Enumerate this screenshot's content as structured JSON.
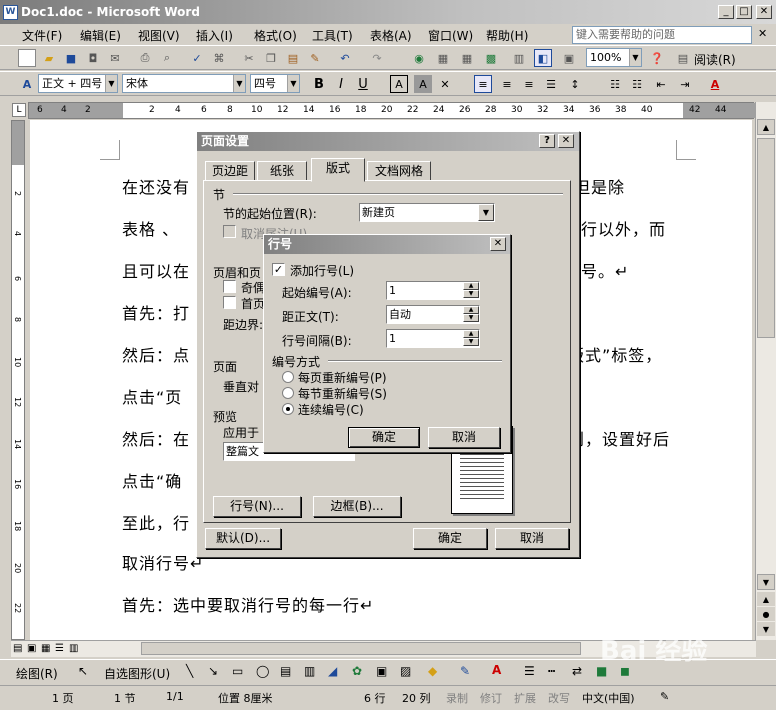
{
  "window": {
    "title": "Doc1.doc - Microsoft Word",
    "minimize": "_",
    "maximize": "□",
    "close": "✕"
  },
  "menu": {
    "items": [
      "文件(F)",
      "编辑(E)",
      "视图(V)",
      "插入(I)",
      "格式(O)",
      "工具(T)",
      "表格(A)",
      "窗口(W)",
      "帮助(H)"
    ],
    "help_placeholder": "键入需要帮助的问题"
  },
  "toolbar": {
    "zoom": "100%",
    "read_label": "阅读(R)"
  },
  "format_bar": {
    "style": "正文 + 四号",
    "font": "宋体",
    "size": "四号",
    "bold": "B",
    "italic": "I",
    "underline": "U"
  },
  "ruler": {
    "numbers": [
      "6",
      "4",
      "2",
      "2",
      "4",
      "6",
      "8",
      "10",
      "12",
      "14",
      "16",
      "18",
      "20",
      "22",
      "24",
      "26",
      "28",
      "30",
      "32",
      "34",
      "36",
      "38",
      "40",
      "42",
      "44"
    ]
  },
  "vruler": {
    "numbers": [
      "2",
      "4",
      "6",
      "8",
      "10",
      "12",
      "14",
      "16",
      "18",
      "20",
      "22"
    ]
  },
  "document": {
    "lines": [
      "在还没有",
      "表格 、",
      "且可以在",
      "首先：打",
      "然后：点",
      "点击“页",
      "然后：在",
      "点击“确",
      "至此，行",
      "取消行号↵",
      "首先：选中要取消行号的每一行↵"
    ],
    "right_fragments": [
      "数，但是除",
      "的行以外，而",
      "行号。↵",
      "",
      "版式”标签，",
      "",
      "到，设置好后"
    ]
  },
  "page_setup": {
    "title": "页面设置",
    "help_btn": "?",
    "close_btn": "✕",
    "tabs": [
      "页边距",
      "纸张",
      "版式",
      "文档网格"
    ],
    "section_group": "节",
    "section_start_label": "节的起始位置(R):",
    "section_start_value": "新建页",
    "cancel_endnote": "取消尾注(U)",
    "header_group": "页眉和页",
    "odd_even": "奇偶",
    "first_page": "首页",
    "from_edge": "距边界:",
    "page_group": "页面",
    "valign": "垂直对",
    "preview_group": "预览",
    "apply_to": "应用于",
    "apply_value": "整篇文",
    "line_numbers_btn": "行号(N)...",
    "borders_btn": "边框(B)...",
    "default_btn": "默认(D)...",
    "ok_btn": "确定",
    "cancel_btn": "取消"
  },
  "line_numbers": {
    "title": "行号",
    "close_btn": "✕",
    "add_label": "添加行号(L)",
    "add_checked": true,
    "start_label": "起始编号(A):",
    "start_value": "1",
    "from_text_label": "距正文(T):",
    "from_text_value": "自动",
    "count_by_label": "行号间隔(B):",
    "count_by_value": "1",
    "numbering_group": "编号方式",
    "options": [
      "每页重新编号(P)",
      "每节重新编号(S)",
      "连续编号(C)"
    ],
    "selected_index": 2,
    "ok_btn": "确定",
    "cancel_btn": "取消"
  },
  "drawing": {
    "draw_label": "绘图(R)",
    "autoshapes": "自选图形(U)"
  },
  "status": {
    "page": "1 页",
    "section": "1 节",
    "pages": "1/1",
    "position": "位置 8厘米",
    "line": "6 行",
    "col": "20 列",
    "rec": "录制",
    "trk": "修订",
    "ext": "扩展",
    "ovr": "改写",
    "lang": "中文(中国)"
  },
  "watermark": "Bai 经验"
}
